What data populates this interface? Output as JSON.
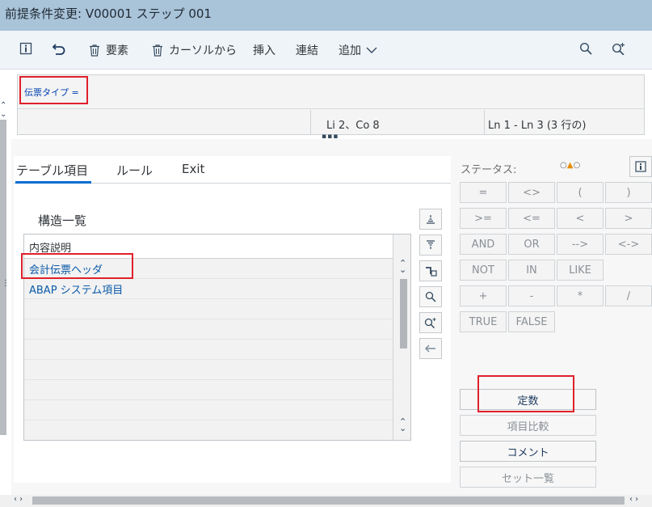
{
  "title": "前提条件変更: V00001 ステップ 001",
  "toolbar": {
    "delete_label": "要素",
    "cursor_label": "カーソルから",
    "insert_label": "挿入",
    "concat_label": "連結",
    "add_label": "追加"
  },
  "editor": {
    "code": "伝票タイプ  =",
    "position": "Li 2、Co 8",
    "lines": "Ln 1 - Ln 3 (3 行の)"
  },
  "tabs": [
    {
      "label": "テーブル項目"
    },
    {
      "label": "ルール"
    },
    {
      "label": "Exit"
    }
  ],
  "structure": {
    "title": "構造一覧",
    "column_header": "内容説明",
    "rows": [
      {
        "label": "会計伝票ヘッダ"
      },
      {
        "label": "ABAP システム項目"
      }
    ]
  },
  "status": {
    "label": "ステータス:"
  },
  "operators": {
    "row1": [
      "=",
      "<>",
      "(",
      ")"
    ],
    "row2": [
      ">=",
      "<=",
      "<",
      ">"
    ],
    "row3": [
      "AND",
      "OR",
      "-->",
      "<->"
    ],
    "row4": [
      "NOT",
      "IN",
      "LIKE"
    ],
    "row5": [
      "+",
      "-",
      "*",
      "/"
    ],
    "row6": [
      "TRUE",
      "FALSE"
    ]
  },
  "actions": {
    "constant": "定数",
    "compare": "項目比較",
    "comment": "コメント",
    "setlist": "セット一覧"
  },
  "colors": {
    "titlebar": "#a9c3d9",
    "highlight": "#e0202a",
    "link": "#0a5aa8",
    "tab_active": "#0a6ed1"
  }
}
